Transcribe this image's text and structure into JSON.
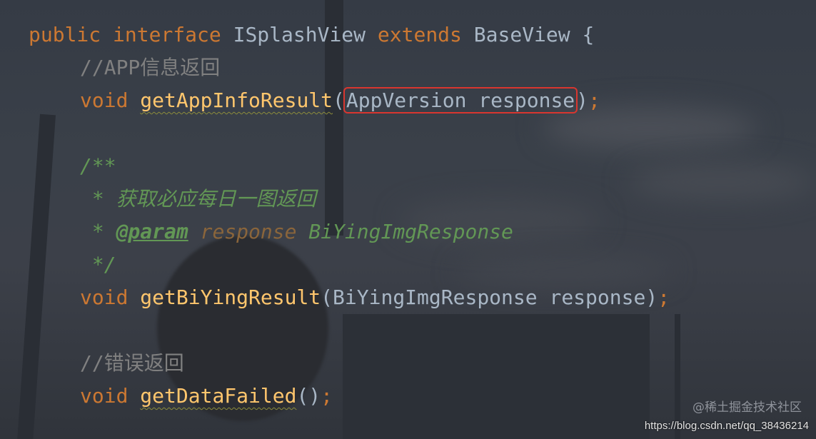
{
  "code": {
    "line1": {
      "kw1": "public",
      "kw2": "interface",
      "name": "ISplashView",
      "kw3": "extends",
      "base": "BaseView",
      "brace": "{"
    },
    "line2": {
      "comment": "//APP信息返回"
    },
    "line3": {
      "type": "void",
      "method": "getAppInfoResult",
      "open": "(",
      "param": "AppVersion response",
      "close": ")",
      "semi": ";"
    },
    "line5": {
      "text": "/**"
    },
    "line6": {
      "star": " * ",
      "text": "获取必应每日一图返回"
    },
    "line7": {
      "star": " * ",
      "tag": "@param",
      "name": "response",
      "desc": "BiYingImgResponse"
    },
    "line8": {
      "text": " */"
    },
    "line9": {
      "type": "void",
      "method": "getBiYingResult",
      "open": "(",
      "param": "BiYingImgResponse response",
      "close": ")",
      "semi": ";"
    },
    "line11": {
      "comment": "//错误返回"
    },
    "line12": {
      "type": "void",
      "method": "getDataFailed",
      "parens": "()",
      "semi": ";"
    }
  },
  "watermark": "@稀土掘金技术社区",
  "url": "https://blog.csdn.net/qq_38436214",
  "colors": {
    "keyword": "#cc7832",
    "method": "#ffc66d",
    "plain": "#a9b7c6",
    "comment": "#808080",
    "doc": "#629755",
    "highlight": "#d9362f"
  }
}
